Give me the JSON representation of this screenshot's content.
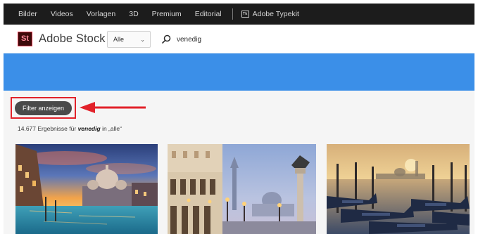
{
  "topnav": {
    "items": [
      "Bilder",
      "Videos",
      "Vorlagen",
      "3D",
      "Premium",
      "Editorial"
    ],
    "typekit": {
      "badge": "Tk",
      "label": "Adobe Typekit"
    }
  },
  "header": {
    "logo_mark": "St",
    "logo_text": "Adobe Stock",
    "select_value": "Alle",
    "search_value": "venedig"
  },
  "filter": {
    "button_label": "Filter anzeigen"
  },
  "results": {
    "count": "14.677",
    "prefix": "Ergebnisse für",
    "query": "venedig",
    "scope": "in „alle“"
  },
  "thumbnails": [
    {
      "name": "venice-grand-canal-sunset-photo"
    },
    {
      "name": "venice-piazzetta-san-marco-dusk-photo"
    },
    {
      "name": "venice-gondolas-lagoon-sunrise-photo"
    }
  ],
  "colors": {
    "banner": "#3b8fe8",
    "annotation": "#e2222a",
    "nav_bg": "#1c1c1c",
    "button_bg": "#4a4a4a"
  }
}
